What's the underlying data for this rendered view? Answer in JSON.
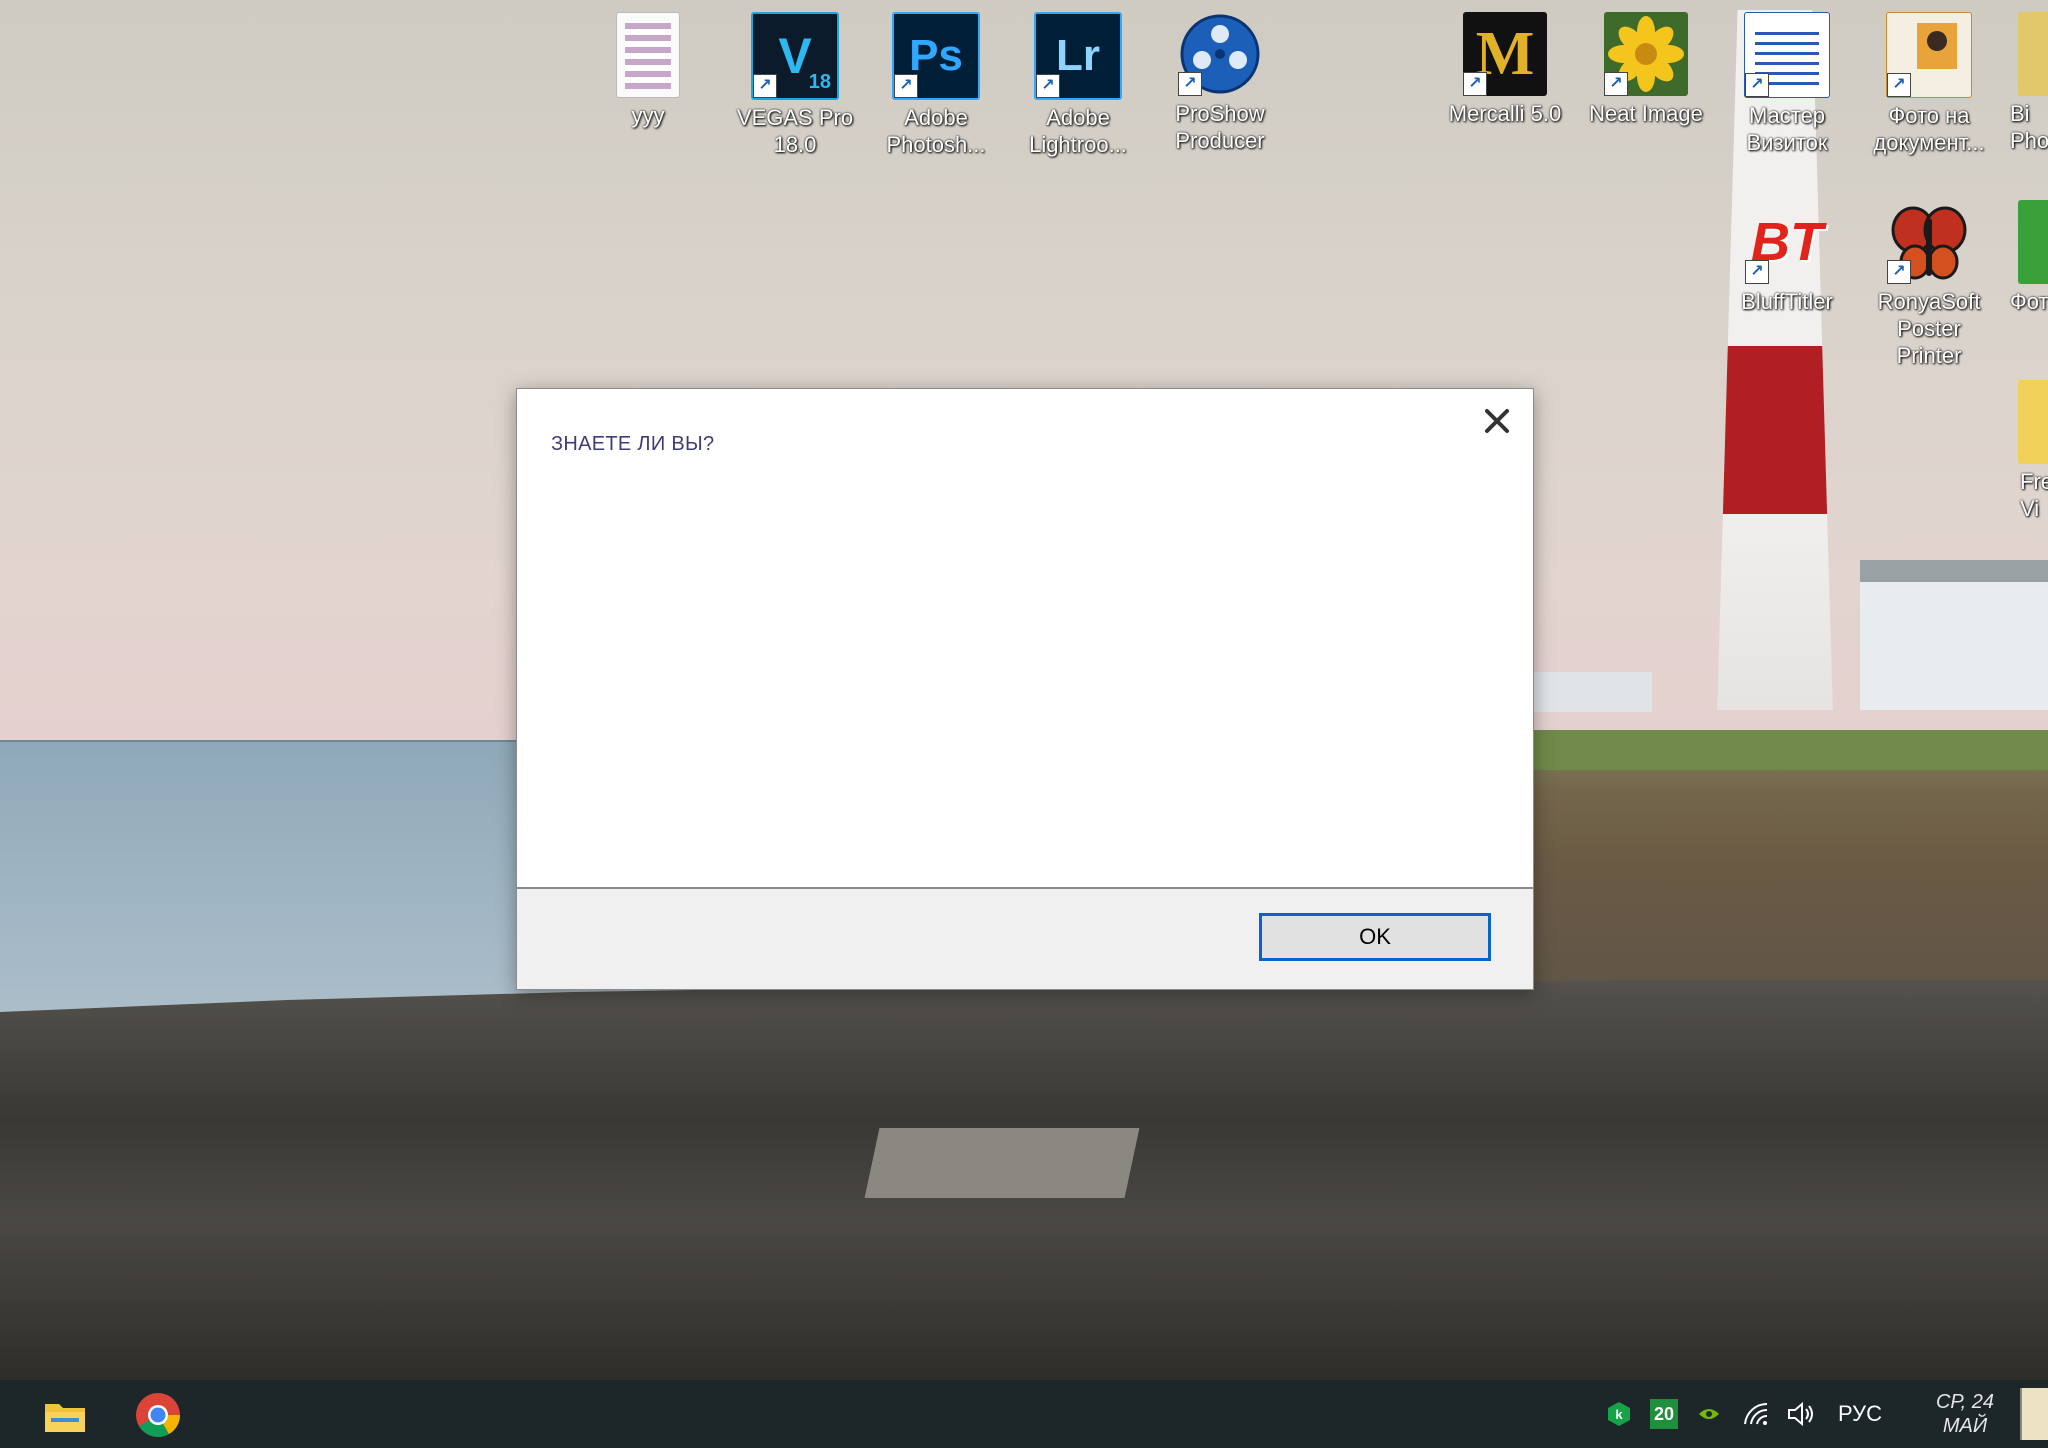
{
  "desktop": {
    "icons": [
      {
        "label": "yyy"
      },
      {
        "label": "VEGAS Pro 18.0",
        "badge": "V",
        "sub": "18"
      },
      {
        "label": "Adobe Photosh...",
        "badge": "Ps"
      },
      {
        "label": "Adobe Lightroo...",
        "badge": "Lr"
      },
      {
        "label": "ProShow Producer"
      },
      {
        "label": "Mercalli 5.0",
        "badge": "M"
      },
      {
        "label": "Neat Image"
      },
      {
        "label": "Мастер Визиток"
      },
      {
        "label": "Фото на документ..."
      },
      {
        "label": "Bi Pho"
      },
      {
        "label": "BluffTitler",
        "badge": "BT"
      },
      {
        "label": "RonyaSoft Poster Printer"
      },
      {
        "label": "Фот"
      },
      {
        "label": "Fre Vi"
      }
    ]
  },
  "dialog": {
    "title": "ЗНАЕТЕ ЛИ ВЫ?",
    "ok_label": "OK"
  },
  "taskbar": {
    "tray": {
      "badge_count": "20",
      "language": "РУС",
      "clock_line1": "СР, 24",
      "clock_line2": "МАЙ"
    }
  },
  "colors": {
    "accent": "#0a64c8",
    "taskbar": "#1d2629",
    "dialog_title": "#3d3d7a"
  }
}
